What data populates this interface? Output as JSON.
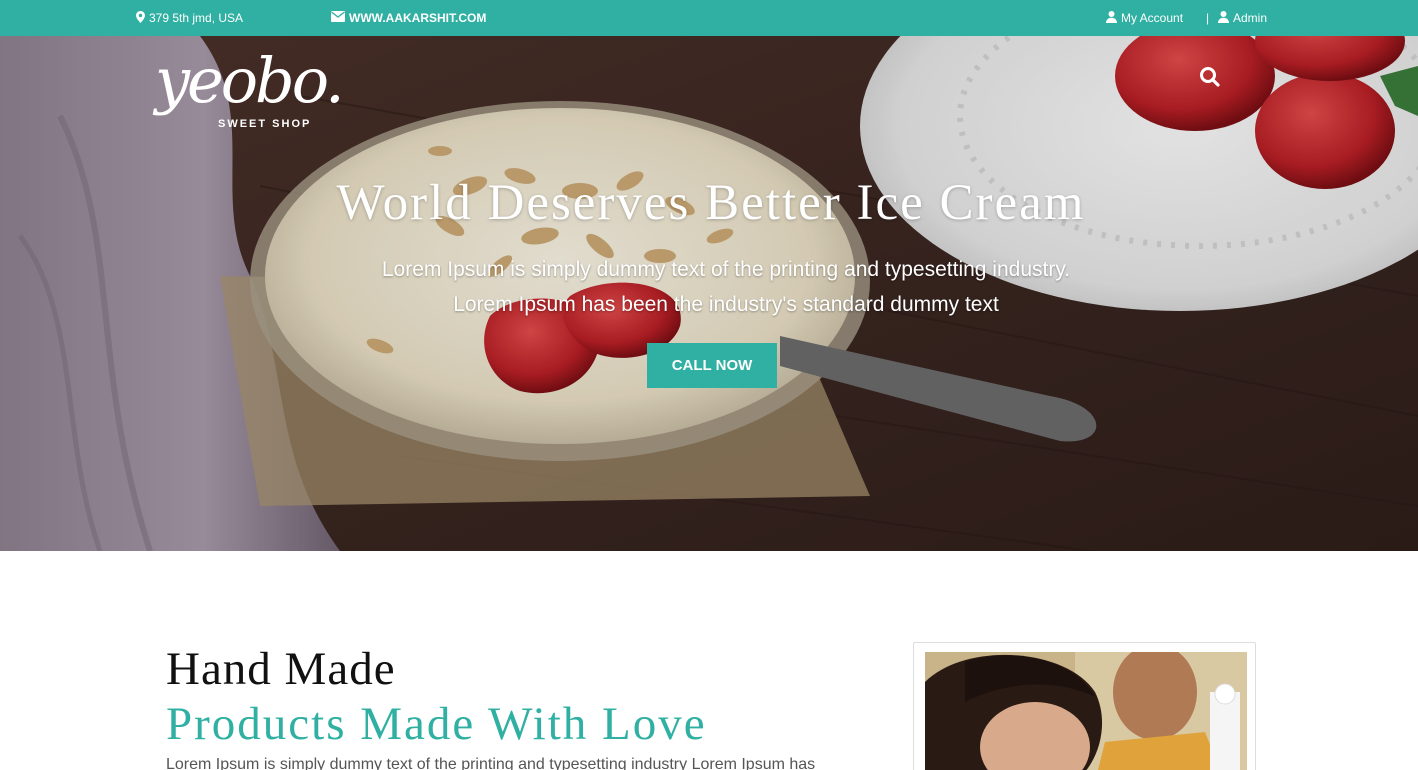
{
  "topbar": {
    "address": "379 5th jmd, USA",
    "website": "WWW.AAKARSHIT.COM",
    "my_account": "My Account",
    "separator": "|",
    "admin": "Admin",
    "background": "#2fb0a2"
  },
  "logo": {
    "word": "yeobo.",
    "subtitle": "SWEET SHOP"
  },
  "hero": {
    "title": "World Deserves Better Ice Cream",
    "line1": "Lorem Ipsum is simply dummy text of the printing and typesetting industry.",
    "line2": "Lorem Ipsum has been the industry's standard dummy text",
    "cta_label": "CALL NOW"
  },
  "about": {
    "heading": "Hand Made",
    "subheading": "Products Made With Love",
    "text": "Lorem Ipsum is simply dummy text of the printing and typesetting industry Lorem Ipsum has"
  },
  "icons": {
    "address": "map-marker-icon",
    "website": "envelope-icon",
    "account": "user-icon",
    "admin": "user-icon",
    "search": "search-icon"
  },
  "colors": {
    "accent": "#2fb0a2"
  }
}
